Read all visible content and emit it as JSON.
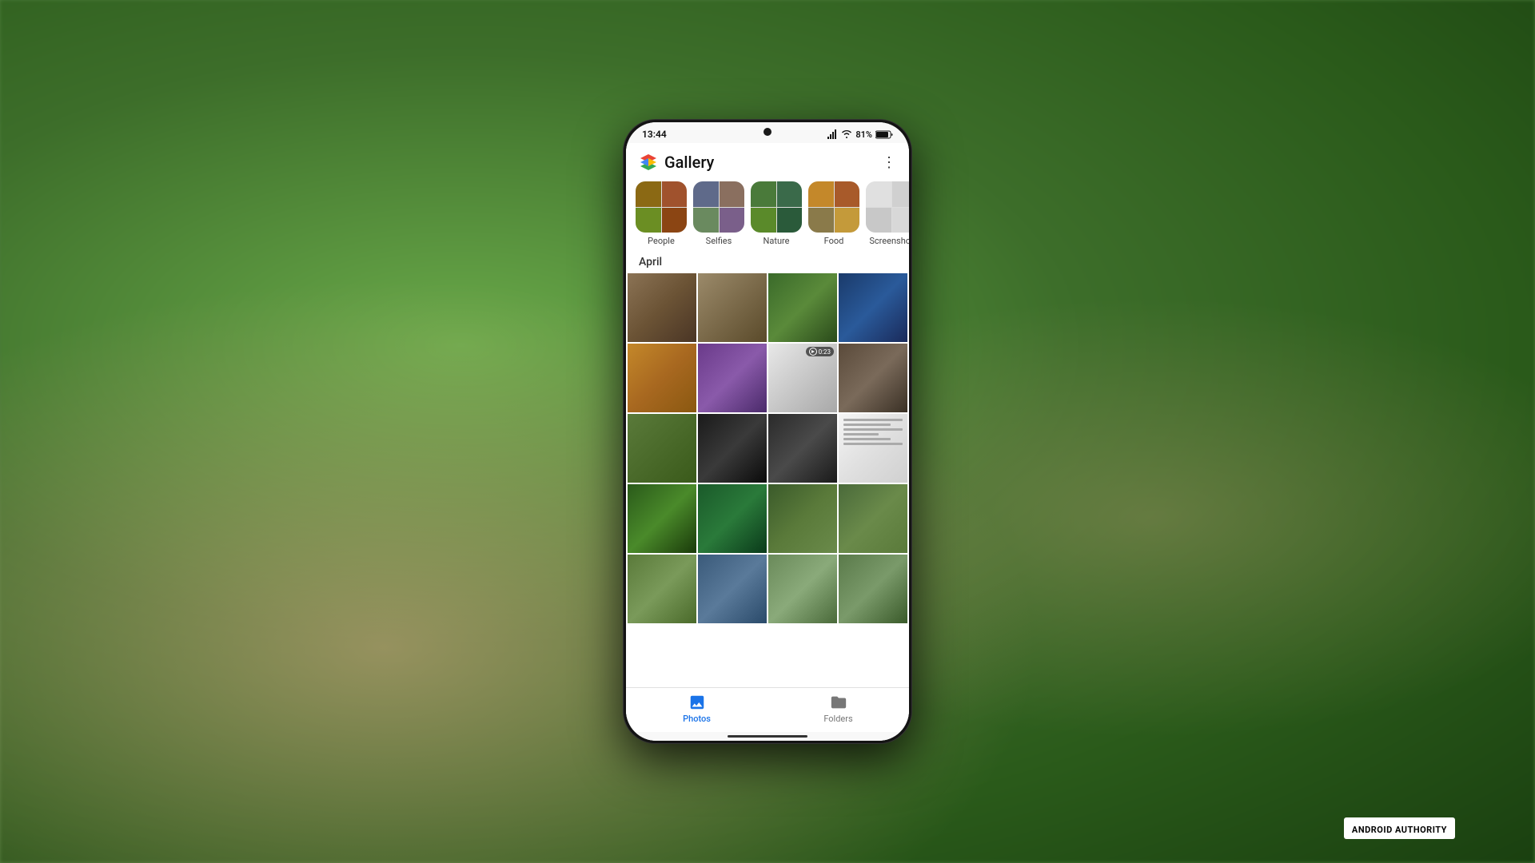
{
  "background": {
    "color": "#4a7a3a"
  },
  "phone": {
    "status_bar": {
      "time": "13:44",
      "battery": "81%",
      "signal": "▲▼",
      "wifi": "WiFi"
    },
    "app": {
      "title": "Gallery",
      "menu_icon": "⋮"
    },
    "categories": [
      {
        "id": "people",
        "label": "People"
      },
      {
        "id": "selfies",
        "label": "Selfies"
      },
      {
        "id": "nature",
        "label": "Nature"
      },
      {
        "id": "food",
        "label": "Food"
      },
      {
        "id": "screenshots",
        "label": "Screenshot"
      }
    ],
    "section_label": "April",
    "photo_grid": {
      "rows": [
        [
          "dog1",
          "dog2",
          "nature1",
          "screen1"
        ],
        [
          "food1",
          "purple",
          "catdog",
          "dog3"
        ],
        [
          "monkey",
          "blackdog",
          "blackdog2",
          "letter"
        ],
        [
          "forest",
          "hair",
          "dinner",
          "dinner2"
        ],
        [
          "dinner3",
          "boat",
          "dinner4",
          "dinner5"
        ]
      ]
    },
    "bottom_nav": [
      {
        "id": "photos",
        "label": "Photos",
        "active": true
      },
      {
        "id": "folders",
        "label": "Folders",
        "active": false
      }
    ],
    "video_badge": "0:23"
  },
  "watermark": {
    "text": "ANDROID AUTHORITY"
  }
}
